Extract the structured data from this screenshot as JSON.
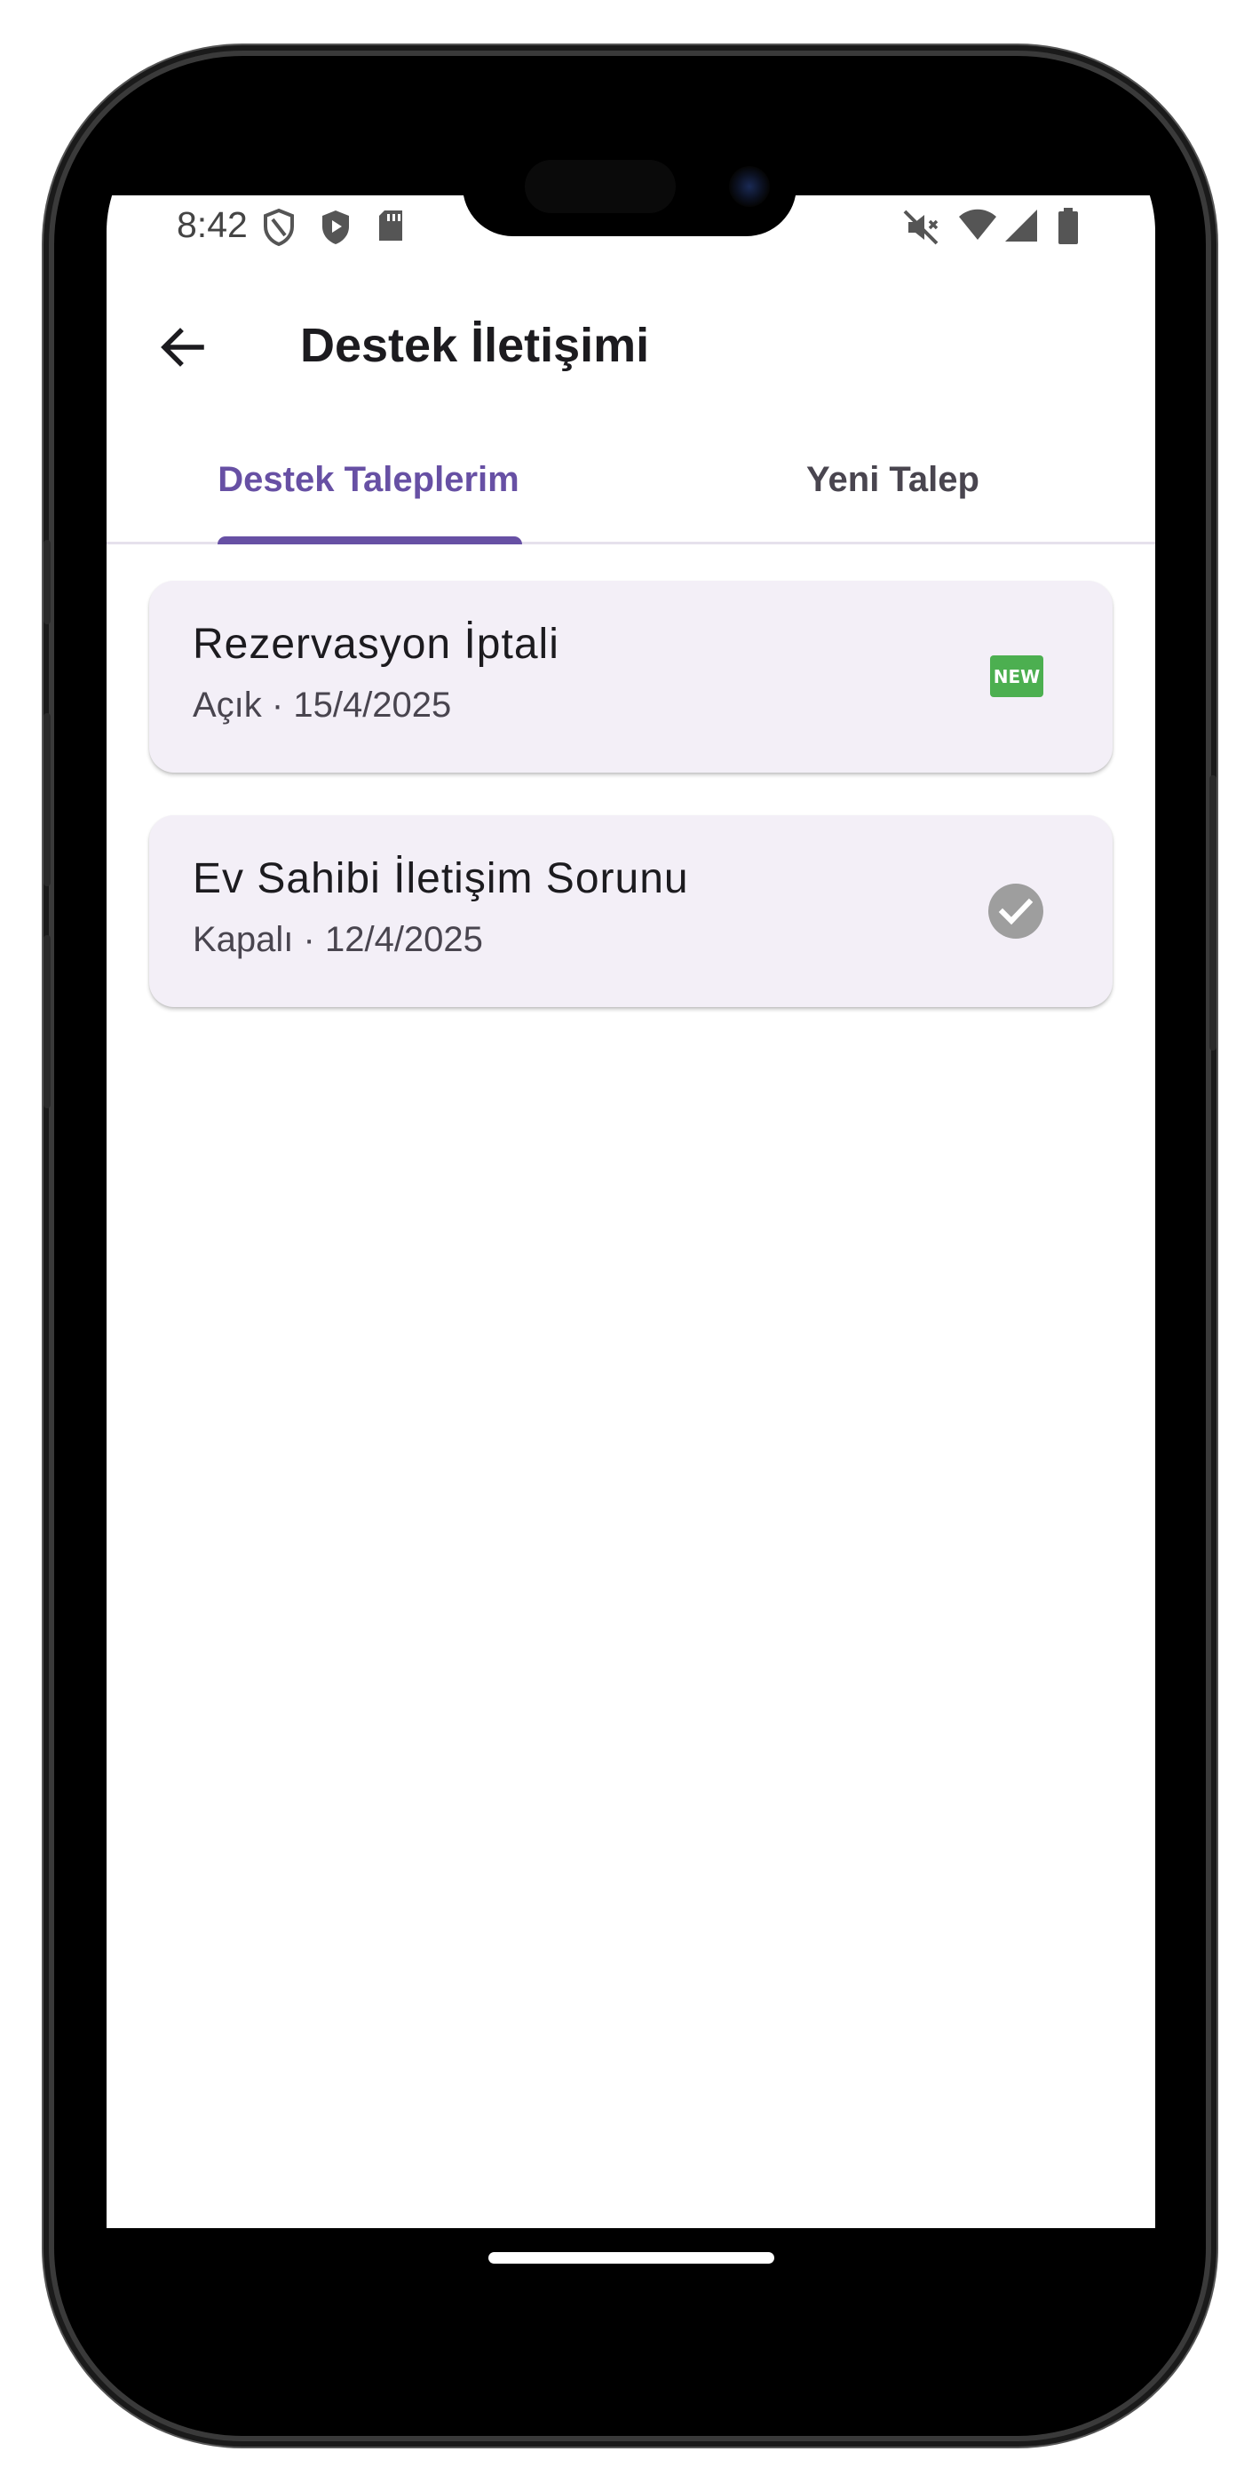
{
  "status_bar": {
    "time": "8:42",
    "left_icons": [
      "shield-outline-icon",
      "shield-play-icon",
      "sd-card-icon"
    ],
    "right_icons": [
      "mute-icon",
      "wifi-icon",
      "signal-icon",
      "battery-icon"
    ]
  },
  "app_bar": {
    "back_icon": "arrow-back-icon",
    "title": "Destek İletişimi"
  },
  "tabs": [
    {
      "label": "Destek Taleplerim",
      "selected": true
    },
    {
      "label": "Yeni Talep",
      "selected": false
    }
  ],
  "tickets": [
    {
      "title": "Rezervasyon İptali",
      "subtitle": "Açık · 15/4/2025",
      "status_icon": "new-badge-icon",
      "badge_text": "NEW"
    },
    {
      "title": "Ev Sahibi İletişim Sorunu",
      "subtitle": "Kapalı · 12/4/2025",
      "status_icon": "check-circle-icon"
    }
  ],
  "colors": {
    "primary": "#6750a4",
    "card_background": "#f3eff7",
    "new_badge": "#4caf50",
    "closed_icon": "#9e9e9e"
  }
}
